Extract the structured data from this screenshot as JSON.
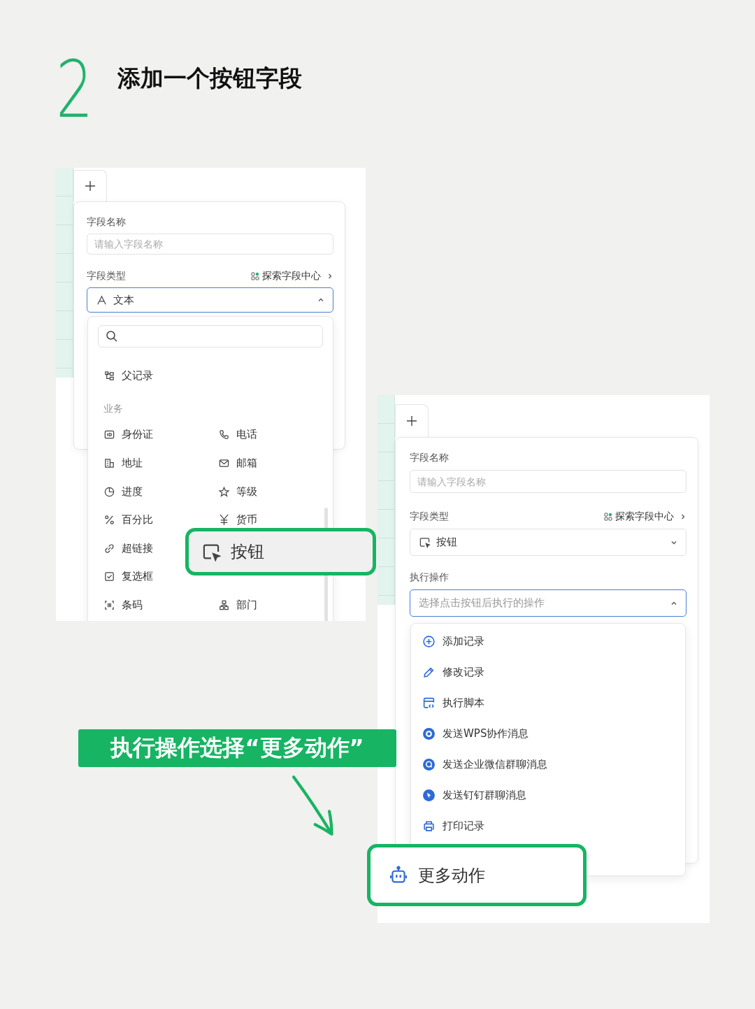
{
  "step": {
    "number": "2",
    "title": "添加一个按钮字段"
  },
  "screen_1": {
    "field_name": {
      "label": "字段名称",
      "placeholder": "请输入字段名称"
    },
    "field_type": {
      "label": "字段类型",
      "link": "探索字段中心",
      "value": "文本",
      "kind": "text",
      "expanded": true
    },
    "type_menu": {
      "rows": [
        {
          "left": {
            "kind": "parent",
            "label": "父记录"
          }
        },
        {
          "group": "业务"
        },
        {
          "left": {
            "kind": "id",
            "label": "身份证"
          },
          "right": {
            "kind": "phone",
            "label": "电话"
          }
        },
        {
          "left": {
            "kind": "address",
            "label": "地址"
          },
          "right": {
            "kind": "mail",
            "label": "邮箱"
          }
        },
        {
          "left": {
            "kind": "progress",
            "label": "进度"
          },
          "right": {
            "kind": "star",
            "label": "等级"
          }
        },
        {
          "left": {
            "kind": "percent",
            "label": "百分比"
          },
          "right": {
            "kind": "currency",
            "label": "货币"
          }
        },
        {
          "left": {
            "kind": "link",
            "label": "超链接"
          }
        },
        {
          "left": {
            "kind": "checkbox",
            "label": "复选框"
          }
        },
        {
          "left": {
            "kind": "barcode",
            "label": "条码"
          },
          "right": {
            "kind": "department",
            "label": "部门"
          }
        }
      ]
    },
    "callout": {
      "kind": "button",
      "label": "按钮"
    }
  },
  "screen_2": {
    "field_name": {
      "label": "字段名称",
      "placeholder": "请输入字段名称"
    },
    "field_type": {
      "label": "字段类型",
      "link": "探索字段中心",
      "value": "按钮",
      "kind": "button",
      "expanded": false
    },
    "action": {
      "label": "执行操作",
      "placeholder": "选择点击按钮后执行的操作",
      "expanded": true
    },
    "action_menu": [
      {
        "kind": "add",
        "label": "添加记录"
      },
      {
        "kind": "edit",
        "label": "修改记录"
      },
      {
        "kind": "script",
        "label": "执行脚本"
      },
      {
        "kind": "ring",
        "label": "发送WPS协作消息"
      },
      {
        "kind": "chat",
        "label": "发送企业微信群聊消息"
      },
      {
        "kind": "wing",
        "label": "发送钉钉群聊消息"
      },
      {
        "kind": "print",
        "label": "打印记录"
      }
    ],
    "callout": {
      "kind": "robot",
      "label": "更多动作"
    }
  },
  "annotation": "执行操作选择“更多动作”"
}
